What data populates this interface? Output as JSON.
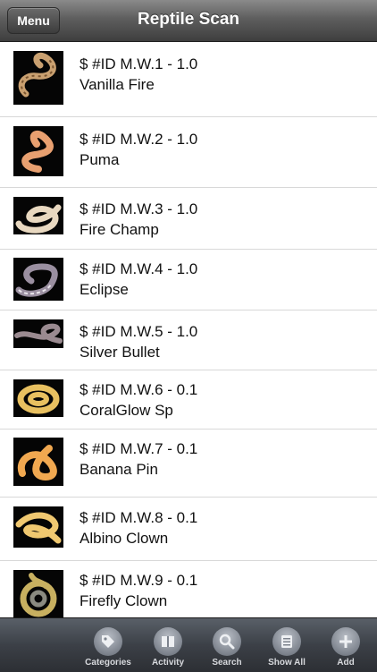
{
  "navbar": {
    "menu_label": "Menu",
    "title": "Reptile Scan"
  },
  "list": {
    "items": [
      {
        "id_text": "$ #ID M.W.1 - 1.0",
        "name": "Vanilla Fire",
        "thumb": "snake-thumbnail"
      },
      {
        "id_text": "$ #ID M.W.2 - 1.0",
        "name": "Puma",
        "thumb": "snake-thumbnail"
      },
      {
        "id_text": "$ #ID M.W.3 - 1.0",
        "name": "Fire Champ",
        "thumb": "snake-thumbnail"
      },
      {
        "id_text": "$ #ID M.W.4 - 1.0",
        "name": "Eclipse",
        "thumb": "snake-thumbnail"
      },
      {
        "id_text": "$ #ID M.W.5 - 1.0",
        "name": "Silver Bullet",
        "thumb": "snake-thumbnail"
      },
      {
        "id_text": "$ #ID M.W.6 - 0.1",
        "name": "CoralGlow Sp",
        "thumb": "snake-thumbnail"
      },
      {
        "id_text": "$ #ID M.W.7 - 0.1",
        "name": "Banana Pin",
        "thumb": "snake-thumbnail"
      },
      {
        "id_text": "$ #ID M.W.8 - 0.1",
        "name": "Albino Clown",
        "thumb": "snake-thumbnail"
      },
      {
        "id_text": "$ #ID M.W.9 - 0.1",
        "name": "Firefly Clown",
        "thumb": "snake-thumbnail"
      }
    ]
  },
  "tabbar": {
    "tabs": [
      {
        "label": "Categories",
        "icon": "tag-icon"
      },
      {
        "label": "Activity",
        "icon": "book-icon"
      },
      {
        "label": "Search",
        "icon": "search-icon"
      },
      {
        "label": "Show All",
        "icon": "list-icon"
      },
      {
        "label": "Add",
        "icon": "plus-icon"
      }
    ]
  },
  "colors": {
    "navbar": "#5e5e5e",
    "tabbar": "#3c4047",
    "snake_tones": [
      "#c9a070",
      "#e8a070",
      "#e8d8c0",
      "#9a8fa0",
      "#9a8a90",
      "#e8c060",
      "#f0a850",
      "#f0c870",
      "#c8b060"
    ]
  }
}
